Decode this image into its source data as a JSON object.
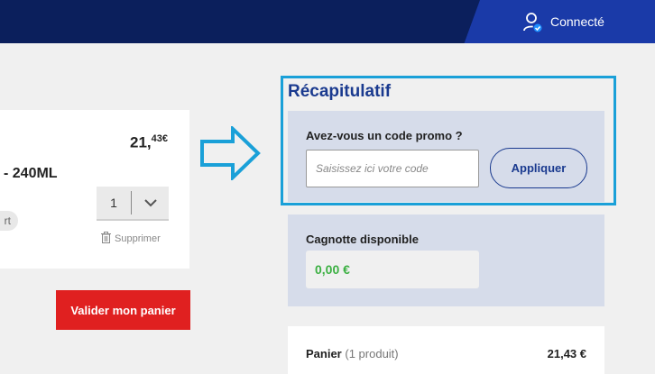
{
  "header": {
    "account_label": "Connecté"
  },
  "product": {
    "price_main": "21,",
    "price_cents": "43€",
    "name_fragment": "- 240ML",
    "tag_fragment": "rt",
    "quantity": "1",
    "delete_label": "Supprimer"
  },
  "cart_actions": {
    "validate_label": "Valider mon panier"
  },
  "summary": {
    "title": "Récapitulatif",
    "promo_label": "Avez-vous un code promo ?",
    "promo_placeholder": "Saisissez ici votre code",
    "apply_label": "Appliquer",
    "cagnotte_label": "Cagnotte disponible",
    "cagnotte_value": "0,00 €",
    "cart_label": "Panier",
    "cart_count": "(1 produit)",
    "cart_total": "21,43 €"
  },
  "colors": {
    "header_dark": "#0b1f5c",
    "header_accent": "#1a3aa8",
    "brand_blue": "#1a3a8f",
    "highlight": "#1aa0d8",
    "cta_red": "#e02020",
    "success_green": "#3cb043"
  },
  "icons": {
    "account": "user-check-icon",
    "quantity_toggle": "chevron-down-icon",
    "delete": "trash-icon",
    "pointer": "arrow-right-icon"
  }
}
